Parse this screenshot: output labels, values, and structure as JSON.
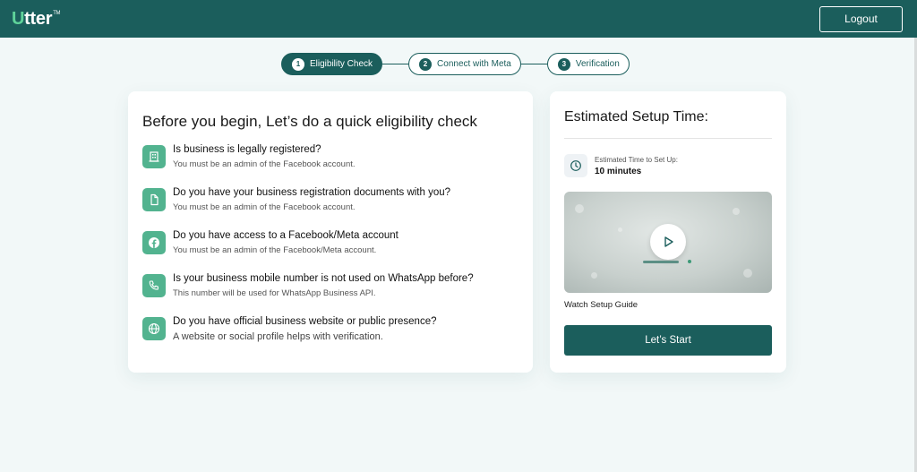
{
  "header": {
    "logo_first": "U",
    "logo_rest": "tter",
    "logo_tm": "TM",
    "logout_label": "Logout"
  },
  "stepper": {
    "steps": [
      {
        "num": "1",
        "label": "Eligibility Check",
        "state": "active"
      },
      {
        "num": "2",
        "label": "Connect with Meta",
        "state": "upcoming"
      },
      {
        "num": "3",
        "label": "Verification",
        "state": "upcoming"
      }
    ]
  },
  "eligibility": {
    "title": "Before you begin, Let’s do a quick eligibility check",
    "items": [
      {
        "icon": "building-icon",
        "question": "Is business is legally registered?",
        "desc": "You must be an admin of the Facebook account."
      },
      {
        "icon": "document-icon",
        "question": "Do you have your business registration documents with you?",
        "desc": "You must be an admin of the Facebook account."
      },
      {
        "icon": "facebook-icon",
        "question": "Do you have access to a Facebook/Meta account",
        "desc": "You must be an admin of the Facebook/Meta account."
      },
      {
        "icon": "phone-icon",
        "question": "Is your business mobile number is not used on WhatsApp before?",
        "desc": "This number will be used for WhatsApp Business API."
      },
      {
        "icon": "globe-icon",
        "question": "Do you have official business website or public presence?",
        "desc": "A website or social profile helps with verification."
      }
    ]
  },
  "setup": {
    "title": "Estimated Setup Time:",
    "time_label": "Estimated Time to Set Up:",
    "time_value": "10 minutes",
    "watch_label": "Watch Setup Guide",
    "start_label": "Let’s Start"
  },
  "colors": {
    "primary": "#1b5e5c",
    "accent": "#52b38f",
    "background": "#f2f8f8"
  }
}
